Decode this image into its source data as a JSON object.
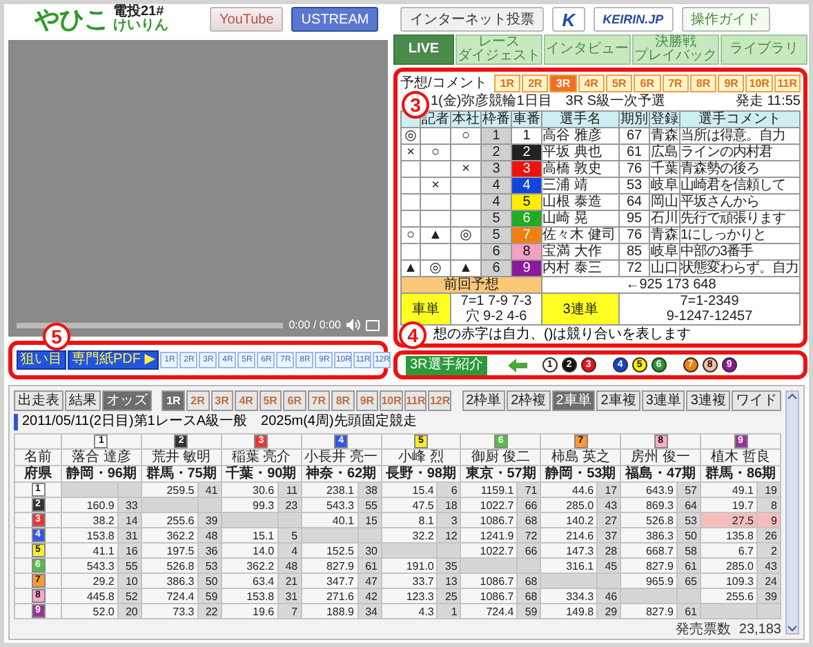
{
  "header": {
    "logo": {
      "main": "やひこ",
      "top": "電投21#",
      "bottom": "けいりん"
    },
    "links": [
      {
        "label": "YouTube",
        "kind": "youtube"
      },
      {
        "label": "USTREAM",
        "kind": "ustream"
      },
      {
        "label": "インターネット投票",
        "kind": "plain"
      },
      {
        "label": "K",
        "kind": "kdreams"
      },
      {
        "label": "KEIRIN.JP",
        "kind": "keirin"
      },
      {
        "label": "操作ガイド",
        "kind": "guide"
      }
    ]
  },
  "video": {
    "time": "0:00 / 0:00"
  },
  "race_links": {
    "buttons": [
      "狙い目",
      "専門紙PDF ▶"
    ],
    "races": [
      "1R",
      "2R",
      "3R",
      "4R",
      "5R",
      "6R",
      "7R",
      "8R",
      "9R",
      "10R",
      "11R",
      "12R"
    ]
  },
  "tabs": [
    {
      "lines": [
        "LIVE"
      ],
      "selected": true
    },
    {
      "lines": [
        "レース",
        "ダイジェスト"
      ],
      "selected": false
    },
    {
      "lines": [
        "インタビュー"
      ],
      "selected": false
    },
    {
      "lines": [
        "決勝戦",
        "プレイバック"
      ],
      "selected": false
    },
    {
      "lines": [
        "ライブラリ"
      ],
      "selected": false
    }
  ],
  "forecast": {
    "title": "予想/コメント",
    "races": [
      {
        "label": "1R",
        "selected": false
      },
      {
        "label": "2R",
        "selected": false
      },
      {
        "label": "3R",
        "selected": true
      },
      {
        "label": "4R",
        "selected": false
      },
      {
        "label": "5R",
        "selected": false
      },
      {
        "label": "6R",
        "selected": false
      },
      {
        "label": "7R",
        "selected": false
      },
      {
        "label": "8R",
        "selected": false
      },
      {
        "label": "9R",
        "selected": false
      },
      {
        "label": "10R",
        "selected": false
      },
      {
        "label": "11R",
        "selected": false
      }
    ],
    "race_info": "1(金)弥彦競輪1日目　3R S級一次予選",
    "start_time": "発走 11:55",
    "columns": [
      "記者",
      "本社",
      "枠番",
      "車番",
      "選手名",
      "期別",
      "登録",
      "選手コメント"
    ],
    "rows": [
      {
        "marks": {
          "forecast": "◎",
          "company": "○"
        },
        "frame": "1",
        "car": "1",
        "color": "#ffffff",
        "name": "高谷 雅彦",
        "term": "67",
        "pref": "青森",
        "comment": "当所は得意。自力"
      },
      {
        "marks": {
          "forecast": "×",
          "reporter": "○"
        },
        "frame": "2",
        "car": "2",
        "color": "#222222",
        "name": "平坂 典也",
        "term": "61",
        "pref": "広島",
        "comment": "ラインの内村君"
      },
      {
        "marks": {
          "company": "×"
        },
        "frame": "3",
        "car": "3",
        "color": "#ee1111",
        "name": "高橋 敦史",
        "term": "76",
        "pref": "千葉",
        "comment": "青森勢の後ろ"
      },
      {
        "marks": {
          "reporter": "×"
        },
        "frame": "4",
        "car": "4",
        "color": "#1144dd",
        "name": "三浦 靖",
        "term": "53",
        "pref": "岐阜",
        "comment": "山崎君を信頼して"
      },
      {
        "marks": {},
        "frame": "4",
        "car": "5",
        "color": "#ffee00",
        "name": "山根 泰造",
        "term": "64",
        "pref": "岡山",
        "comment": "平坂さんから"
      },
      {
        "marks": {},
        "frame": "5",
        "car": "6",
        "color": "#22aa22",
        "name": "山崎 晃",
        "term": "95",
        "pref": "石川",
        "comment": "先行で頑張ります"
      },
      {
        "marks": {
          "forecast": "○",
          "reporter": "▲",
          "company": "◎"
        },
        "frame": "5",
        "car": "7",
        "color": "#f08010",
        "name": "佐々木 健司",
        "term": "76",
        "pref": "青森",
        "comment": "1にしっかりと"
      },
      {
        "marks": {},
        "frame": "6",
        "car": "8",
        "color": "#f4a0c0",
        "name": "宝満 大作",
        "term": "85",
        "pref": "岐阜",
        "comment": "中部の3番手"
      },
      {
        "marks": {
          "forecast": "▲",
          "reporter": "◎",
          "company": "▲"
        },
        "frame": "6",
        "car": "9",
        "color": "#8a1a9a",
        "name": "内村 泰三",
        "term": "72",
        "pref": "山口",
        "comment": "状態変わらず。自力"
      }
    ],
    "previous": {
      "label": "前回予想",
      "value": "←925 173 648"
    },
    "exacta": {
      "label": "車単",
      "lines": [
        "7=1 7-9 7-3",
        "穴 9-2 4-6"
      ]
    },
    "trifecta": {
      "label": "3連単",
      "lines": [
        "7=1-2349",
        "9-1247-12457"
      ]
    },
    "note": "想の赤字は自力、()は競り合いを表します"
  },
  "intro": {
    "button": "3R選手紹介",
    "numbers": [
      {
        "label": "1",
        "color": "#ffffff"
      },
      {
        "label": "2",
        "color": "#111111"
      },
      {
        "label": "3",
        "color": "#ee1111"
      },
      {
        "label": "4",
        "color": "#1144cc"
      },
      {
        "label": "5",
        "color": "#ffee00"
      },
      {
        "label": "6",
        "color": "#229933"
      },
      {
        "label": "7",
        "color": "#f08010"
      },
      {
        "label": "8",
        "color": "#f8c0a0"
      },
      {
        "label": "9",
        "color": "#8a1a9a"
      }
    ]
  },
  "annotations": [
    "3",
    "4",
    "5"
  ],
  "odds": {
    "views": [
      {
        "label": "出走表",
        "selected": false
      },
      {
        "label": "結果",
        "selected": false
      },
      {
        "label": "オッズ",
        "selected": true
      }
    ],
    "races": [
      {
        "label": "1R",
        "selected": true
      },
      {
        "label": "2R",
        "selected": false
      },
      {
        "label": "3R",
        "selected": false
      },
      {
        "label": "4R",
        "selected": false
      },
      {
        "label": "5R",
        "selected": false
      },
      {
        "label": "6R",
        "selected": false
      },
      {
        "label": "7R",
        "selected": false
      },
      {
        "label": "8R",
        "selected": false
      },
      {
        "label": "9R",
        "selected": false
      },
      {
        "label": "10R",
        "selected": false
      },
      {
        "label": "11R",
        "selected": false
      },
      {
        "label": "12R",
        "selected": false
      }
    ],
    "bet_types": [
      {
        "label": "2枠単",
        "selected": false
      },
      {
        "label": "2枠複",
        "selected": false
      },
      {
        "label": "2車単",
        "selected": true
      },
      {
        "label": "2車複",
        "selected": false
      },
      {
        "label": "3連単",
        "selected": false
      },
      {
        "label": "3連複",
        "selected": false
      },
      {
        "label": "ワイド",
        "selected": false
      }
    ],
    "title": "2011/05/11(2日目)第1レースA級一般　2025m(4周)先頭固定競走",
    "name_label": "名前",
    "pref_label": "府県",
    "riders": [
      {
        "num": "1",
        "color": "#ffffff",
        "name": "落合 達彦",
        "pref": "静岡・96期"
      },
      {
        "num": "2",
        "color": "#333333",
        "name": "荒井 敏明",
        "pref": "群馬・75期"
      },
      {
        "num": "3",
        "color": "#ee3333",
        "name": "稲葉 亮介",
        "pref": "千葉・90期"
      },
      {
        "num": "4",
        "color": "#3355ee",
        "name": "小長井 亮一",
        "pref": "神奈・62期"
      },
      {
        "num": "5",
        "color": "#ffee22",
        "name": "小峰 烈",
        "pref": "長野・98期"
      },
      {
        "num": "6",
        "color": "#55bb44",
        "name": "御厨 俊二",
        "pref": "東京・57期"
      },
      {
        "num": "7",
        "color": "#ff9933",
        "name": "柿島 英之",
        "pref": "静岡・53期"
      },
      {
        "num": "8",
        "color": "#ffaacc",
        "name": "房州 俊一",
        "pref": "福島・47期"
      },
      {
        "num": "9",
        "color": "#993399",
        "name": "植木 哲良",
        "pref": "群馬・86期"
      }
    ],
    "row_labels": [
      {
        "label": "1",
        "color": "#ffffff"
      },
      {
        "label": "2",
        "color": "#333333"
      },
      {
        "label": "3",
        "color": "#ee3333"
      },
      {
        "label": "4",
        "color": "#3355ee"
      },
      {
        "label": "5",
        "color": "#ffee22"
      },
      {
        "label": "6",
        "color": "#55bb44"
      },
      {
        "label": "7",
        "color": "#ff9933"
      },
      {
        "label": "8",
        "color": "#ffaacc"
      },
      {
        "label": "9",
        "color": "#993399"
      }
    ],
    "rows": [
      [
        null,
        {
          "odds": "259.5",
          "rank": "41",
          "highlighted": false
        },
        {
          "odds": "30.6",
          "rank": "11",
          "highlighted": false
        },
        {
          "odds": "238.1",
          "rank": "38",
          "highlighted": false
        },
        {
          "odds": "15.4",
          "rank": "6",
          "highlighted": false
        },
        {
          "odds": "1159.1",
          "rank": "71",
          "highlighted": false
        },
        {
          "odds": "44.6",
          "rank": "17",
          "highlighted": false
        },
        {
          "odds": "643.9",
          "rank": "57",
          "highlighted": false
        },
        {
          "odds": "49.1",
          "rank": "19",
          "highlighted": false
        }
      ],
      [
        {
          "odds": "160.9",
          "rank": "33",
          "highlighted": false
        },
        null,
        {
          "odds": "99.3",
          "rank": "23",
          "highlighted": false
        },
        {
          "odds": "543.3",
          "rank": "55",
          "highlighted": false
        },
        {
          "odds": "47.5",
          "rank": "18",
          "highlighted": false
        },
        {
          "odds": "1022.7",
          "rank": "66",
          "highlighted": false
        },
        {
          "odds": "285.0",
          "rank": "43",
          "highlighted": false
        },
        {
          "odds": "869.3",
          "rank": "64",
          "highlighted": false
        },
        {
          "odds": "19.7",
          "rank": "8",
          "highlighted": false
        }
      ],
      [
        {
          "odds": "38.2",
          "rank": "14",
          "highlighted": false
        },
        {
          "odds": "255.6",
          "rank": "39",
          "highlighted": false
        },
        null,
        {
          "odds": "40.1",
          "rank": "15",
          "highlighted": false
        },
        {
          "odds": "8.1",
          "rank": "3",
          "highlighted": false
        },
        {
          "odds": "1086.7",
          "rank": "68",
          "highlighted": false
        },
        {
          "odds": "140.2",
          "rank": "27",
          "highlighted": false
        },
        {
          "odds": "526.8",
          "rank": "53",
          "highlighted": false
        },
        {
          "odds": "27.5",
          "rank": "9",
          "highlighted": true
        }
      ],
      [
        {
          "odds": "153.8",
          "rank": "31",
          "highlighted": false
        },
        {
          "odds": "362.2",
          "rank": "48",
          "highlighted": false
        },
        {
          "odds": "15.1",
          "rank": "5",
          "highlighted": false
        },
        null,
        {
          "odds": "32.2",
          "rank": "12",
          "highlighted": false
        },
        {
          "odds": "1241.9",
          "rank": "72",
          "highlighted": false
        },
        {
          "odds": "214.6",
          "rank": "37",
          "highlighted": false
        },
        {
          "odds": "386.3",
          "rank": "50",
          "highlighted": false
        },
        {
          "odds": "135.8",
          "rank": "26",
          "highlighted": false
        }
      ],
      [
        {
          "odds": "41.1",
          "rank": "16",
          "highlighted": false
        },
        {
          "odds": "197.5",
          "rank": "36",
          "highlighted": false
        },
        {
          "odds": "14.0",
          "rank": "4",
          "highlighted": false
        },
        {
          "odds": "152.5",
          "rank": "30",
          "highlighted": false
        },
        null,
        {
          "odds": "1022.7",
          "rank": "66",
          "highlighted": false
        },
        {
          "odds": "147.3",
          "rank": "28",
          "highlighted": false
        },
        {
          "odds": "668.7",
          "rank": "58",
          "highlighted": false
        },
        {
          "odds": "6.7",
          "rank": "2",
          "highlighted": false
        }
      ],
      [
        {
          "odds": "543.3",
          "rank": "55",
          "highlighted": false
        },
        {
          "odds": "526.8",
          "rank": "53",
          "highlighted": false
        },
        {
          "odds": "362.2",
          "rank": "48",
          "highlighted": false
        },
        {
          "odds": "827.9",
          "rank": "61",
          "highlighted": false
        },
        {
          "odds": "191.0",
          "rank": "35",
          "highlighted": false
        },
        null,
        {
          "odds": "316.1",
          "rank": "45",
          "highlighted": false
        },
        {
          "odds": "827.9",
          "rank": "61",
          "highlighted": false
        },
        {
          "odds": "285.0",
          "rank": "43",
          "highlighted": false
        }
      ],
      [
        {
          "odds": "29.2",
          "rank": "10",
          "highlighted": false
        },
        {
          "odds": "386.3",
          "rank": "50",
          "highlighted": false
        },
        {
          "odds": "63.4",
          "rank": "21",
          "highlighted": false
        },
        {
          "odds": "347.7",
          "rank": "47",
          "highlighted": false
        },
        {
          "odds": "33.7",
          "rank": "13",
          "highlighted": false
        },
        {
          "odds": "1086.7",
          "rank": "68",
          "highlighted": false
        },
        null,
        {
          "odds": "965.9",
          "rank": "65",
          "highlighted": false
        },
        {
          "odds": "109.3",
          "rank": "24",
          "highlighted": false
        }
      ],
      [
        {
          "odds": "445.8",
          "rank": "52",
          "highlighted": false
        },
        {
          "odds": "724.4",
          "rank": "59",
          "highlighted": false
        },
        {
          "odds": "153.8",
          "rank": "31",
          "highlighted": false
        },
        {
          "odds": "271.6",
          "rank": "42",
          "highlighted": false
        },
        {
          "odds": "123.3",
          "rank": "25",
          "highlighted": false
        },
        {
          "odds": "1086.7",
          "rank": "68",
          "highlighted": false
        },
        {
          "odds": "334.3",
          "rank": "46",
          "highlighted": false
        },
        null,
        {
          "odds": "255.6",
          "rank": "39",
          "highlighted": false
        }
      ],
      [
        {
          "odds": "52.0",
          "rank": "20",
          "highlighted": false
        },
        {
          "odds": "73.3",
          "rank": "22",
          "highlighted": false
        },
        {
          "odds": "19.6",
          "rank": "7",
          "highlighted": false
        },
        {
          "odds": "188.9",
          "rank": "34",
          "highlighted": false
        },
        {
          "odds": "4.3",
          "rank": "1",
          "highlighted": false
        },
        {
          "odds": "724.4",
          "rank": "59",
          "highlighted": false
        },
        {
          "odds": "149.8",
          "rank": "29",
          "highlighted": false
        },
        {
          "odds": "827.9",
          "rank": "61",
          "highlighted": false
        },
        null
      ]
    ],
    "sales_label": "発売票数",
    "sales_value": "23,183"
  }
}
